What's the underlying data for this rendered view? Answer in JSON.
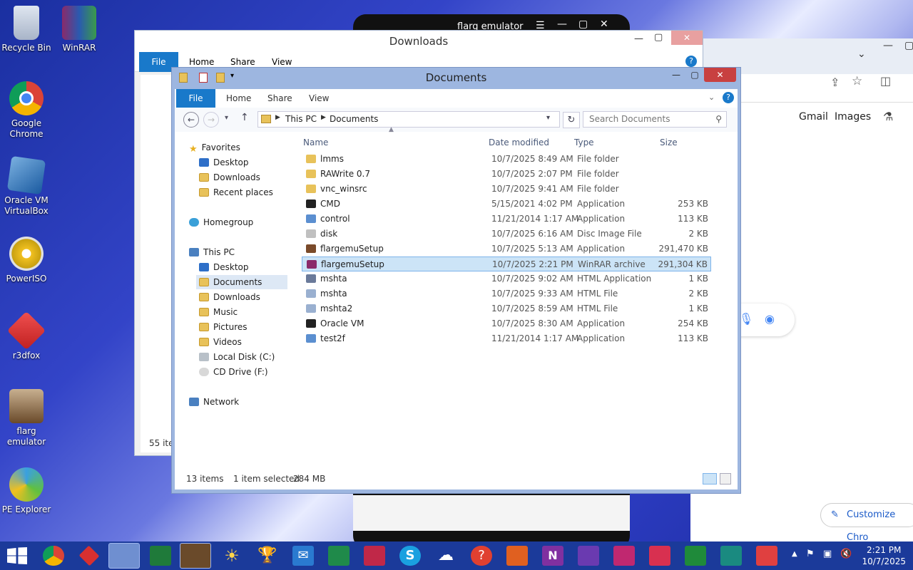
{
  "desktop": {
    "icons": [
      {
        "label": "Recycle Bin"
      },
      {
        "label": "WinRAR"
      },
      {
        "label": "Google Chrome"
      },
      {
        "label": "Oracle VM VirtualBox"
      },
      {
        "label": "PowerISO"
      },
      {
        "label": "r3dfox"
      },
      {
        "label": "flarg emulator"
      },
      {
        "label": "PE Explorer"
      }
    ]
  },
  "flarg_window": {
    "title": "flarg emulator"
  },
  "chrome": {
    "links": [
      "Gmail",
      "Images"
    ],
    "customize": "Customize Chro"
  },
  "downloads_window": {
    "title": "Downloads",
    "tabs": [
      "File",
      "Home",
      "Share",
      "View"
    ],
    "status": "55 ite"
  },
  "documents_window": {
    "title": "Documents",
    "tabs": [
      "File",
      "Home",
      "Share",
      "View"
    ],
    "breadcrumb": [
      "This PC",
      "Documents"
    ],
    "search_placeholder": "Search Documents",
    "nav": {
      "favorites": "Favorites",
      "favorites_items": [
        "Desktop",
        "Downloads",
        "Recent places"
      ],
      "homegroup": "Homegroup",
      "this_pc": "This PC",
      "this_pc_items": [
        "Desktop",
        "Documents",
        "Downloads",
        "Music",
        "Pictures",
        "Videos",
        "Local Disk (C:)",
        "CD Drive (F:)"
      ],
      "network": "Network"
    },
    "columns": {
      "name": "Name",
      "date": "Date modified",
      "type": "Type",
      "size": "Size"
    },
    "files": [
      {
        "name": "lmms",
        "date": "10/7/2025 8:49 AM",
        "type": "File folder",
        "size": "",
        "icon": "folder-icon",
        "color": "#e8c25a"
      },
      {
        "name": "RAWrite 0.7",
        "date": "10/7/2025 2:07 PM",
        "type": "File folder",
        "size": "",
        "icon": "folder-icon",
        "color": "#e8c25a"
      },
      {
        "name": "vnc_winsrc",
        "date": "10/7/2025 9:41 AM",
        "type": "File folder",
        "size": "",
        "icon": "folder-icon",
        "color": "#e8c25a"
      },
      {
        "name": "CMD",
        "date": "5/15/2021 4:02 PM",
        "type": "Application",
        "size": "253 KB",
        "icon": "cmd-icon",
        "color": "#222222"
      },
      {
        "name": "control",
        "date": "11/21/2014 1:17 AM",
        "type": "Application",
        "size": "113 KB",
        "icon": "app-icon",
        "color": "#5b8fd0"
      },
      {
        "name": "disk",
        "date": "10/7/2025 6:16 AM",
        "type": "Disc Image File",
        "size": "2 KB",
        "icon": "disc-icon",
        "color": "#c0c0c0"
      },
      {
        "name": "flargemuSetup",
        "date": "10/7/2025 5:13 AM",
        "type": "Application",
        "size": "291,470 KB",
        "icon": "setup-icon",
        "color": "#7a4a2a"
      },
      {
        "name": "flargemuSetup",
        "date": "10/7/2025 2:21 PM",
        "type": "WinRAR archive",
        "size": "291,304 KB",
        "icon": "winrar-icon",
        "color": "#8a2a6a"
      },
      {
        "name": "mshta",
        "date": "10/7/2025 9:02 AM",
        "type": "HTML Application",
        "size": "1 KB",
        "icon": "hta-icon",
        "color": "#6a7a9a"
      },
      {
        "name": "mshta",
        "date": "10/7/2025 9:33 AM",
        "type": "HTML File",
        "size": "2 KB",
        "icon": "html-icon",
        "color": "#9ab0d0"
      },
      {
        "name": "mshta2",
        "date": "10/7/2025 8:59 AM",
        "type": "HTML File",
        "size": "1 KB",
        "icon": "html-icon",
        "color": "#9ab0d0"
      },
      {
        "name": "Oracle VM",
        "date": "10/7/2025 8:30 AM",
        "type": "Application",
        "size": "254 KB",
        "icon": "cmd-icon",
        "color": "#222222"
      },
      {
        "name": "test2f",
        "date": "11/21/2014 1:17 AM",
        "type": "Application",
        "size": "113 KB",
        "icon": "app-icon",
        "color": "#5b8fd0"
      }
    ],
    "selected_index": 7,
    "status_items": "13 items",
    "status_selected": "1 item selected",
    "status_size": "284 MB"
  },
  "taskbar": {
    "time": "2:21 PM",
    "date": "10/7/2025"
  }
}
